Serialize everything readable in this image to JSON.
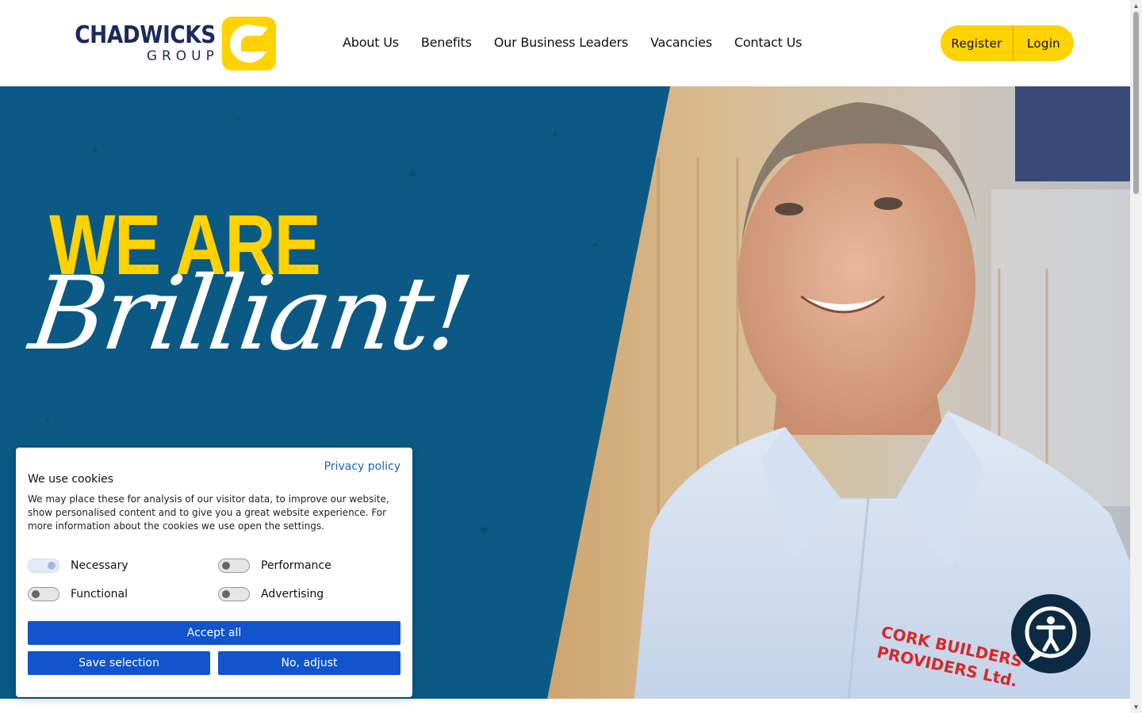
{
  "brand": {
    "name_main": "CHADWICKS",
    "name_sub": "GROUP",
    "logo_mark_icon": "chadwicks-c-icon",
    "accent_color": "#ffd200",
    "navy_color": "#1b2a5c"
  },
  "nav": {
    "items": [
      {
        "label": "About Us"
      },
      {
        "label": "Benefits"
      },
      {
        "label": "Our Business Leaders"
      },
      {
        "label": "Vacancies"
      },
      {
        "label": "Contact Us"
      }
    ]
  },
  "auth": {
    "register_label": "Register",
    "login_label": "Login"
  },
  "hero": {
    "headline_top": "WE ARE",
    "headline_script": "Brilliant!",
    "blue_color": "#0b5a85",
    "shirt_embroidery_line1": "CORK BUILDERS",
    "shirt_embroidery_line2": "PROVIDERS Ltd."
  },
  "cookie": {
    "privacy_link": "Privacy policy",
    "title": "We use cookies",
    "text": "We may place these for analysis of our visitor data, to improve our website, show personalised content and to give you a great website experience. For more information about the cookies we use open the settings.",
    "toggles": [
      {
        "label": "Necessary",
        "on": true
      },
      {
        "label": "Performance",
        "on": false
      },
      {
        "label": "Functional",
        "on": false
      },
      {
        "label": "Advertising",
        "on": false
      }
    ],
    "accept_all_label": "Accept all",
    "save_selection_label": "Save selection",
    "no_adjust_label": "No, adjust",
    "button_color": "#1154cc"
  },
  "accessibility": {
    "icon": "accessibility-person-icon"
  }
}
